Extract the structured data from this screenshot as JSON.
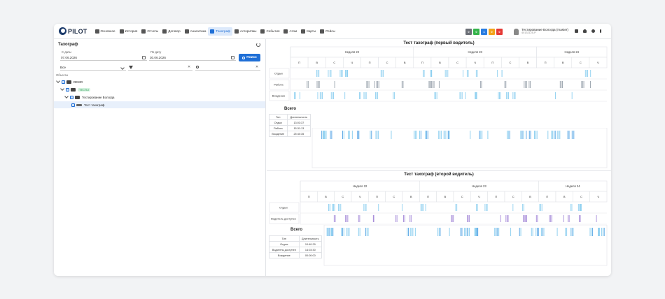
{
  "nav": {
    "logo": "PILOT",
    "items": [
      {
        "label": "Основное",
        "icon": "home-icon"
      },
      {
        "label": "История",
        "icon": "history-icon"
      },
      {
        "label": "Отчеты",
        "icon": "report-icon"
      },
      {
        "label": "Договор",
        "icon": "contract-icon"
      },
      {
        "label": "Аналитика",
        "icon": "analytics-icon"
      },
      {
        "label": "Тахограф",
        "icon": "tachograph-icon",
        "active": true
      },
      {
        "label": "Алгоритмы",
        "icon": "algorithms-icon"
      },
      {
        "label": "События",
        "icon": "bell-icon"
      },
      {
        "label": "Атом",
        "icon": "atom-icon"
      },
      {
        "label": "Карты",
        "icon": "map-icon"
      },
      {
        "label": "Рейсы",
        "icon": "trips-icon"
      }
    ],
    "status_boxes": [
      {
        "value": "0",
        "color": "#6b6f76"
      },
      {
        "value": "0",
        "color": "#34b34a"
      },
      {
        "value": "1",
        "color": "#2a7de1"
      },
      {
        "value": "0",
        "color": "#f2a31a"
      },
      {
        "value": "0",
        "color": "#e53935"
      }
    ],
    "user": {
      "name": "Тестирование Вологда (master)",
      "id": "40132125-P"
    }
  },
  "left_panel": {
    "title": "Тахограф",
    "from_label": "С даты",
    "from_value": "07.06.2026",
    "to_label": "По дату",
    "to_value": "30.06.2026",
    "search_button": "Поиск",
    "select_value": "Все",
    "objects_label": "Объекты",
    "tree": [
      {
        "label": "DEMO",
        "level": 0
      },
      {
        "label": "ТЕСТЫ",
        "level": 1,
        "tag": true
      },
      {
        "label": "Тестирование Вологда",
        "level": 2
      },
      {
        "label": "Тест тахограф",
        "level": 3,
        "selected": true
      }
    ]
  },
  "charts": [
    {
      "title": "Тест тахограф (первый водитель)",
      "weeks": [
        "Неделя 22",
        "Неделя 23",
        "Неделя 24"
      ],
      "days": [
        "П",
        "В",
        "С",
        "Ч",
        "П",
        "С",
        "В",
        "П",
        "В",
        "С",
        "Ч",
        "П",
        "С",
        "В",
        "П",
        "В",
        "С",
        "Ч"
      ],
      "rows": [
        "Отдых",
        "Работа",
        "Вождение"
      ],
      "summary_title": "Всего",
      "summary_headers": [
        "Тип",
        "Длительность"
      ],
      "summary": [
        {
          "type": "Отдых",
          "duration": "13:03:37"
        },
        {
          "type": "Работа",
          "duration": "15:31:13"
        },
        {
          "type": "Вождение",
          "duration": "25:40:35"
        }
      ]
    },
    {
      "title": "Тест тахограф (второй водитель)",
      "weeks": [
        "Неделя 22",
        "Неделя 23",
        "Неделя 24"
      ],
      "days": [
        "П",
        "В",
        "С",
        "Ч",
        "П",
        "С",
        "В",
        "П",
        "В",
        "С",
        "Ч",
        "П",
        "С",
        "В",
        "П",
        "В",
        "С",
        "Ч"
      ],
      "rows": [
        "Отдых",
        "Водитель доступен"
      ],
      "summary_title": "Всего",
      "summary_headers": [
        "Тип",
        "Длительность"
      ],
      "summary": [
        {
          "type": "Отдых",
          "duration": "10:40:29"
        },
        {
          "type": "Водитель доступен",
          "duration": "14:03:30"
        },
        {
          "type": "Вождение",
          "duration": "00:00:00"
        }
      ]
    }
  ],
  "colors": {
    "accent": "#1f6fd6",
    "bar_rest": "#8fd0f0",
    "bar_work": "#9aa3ad",
    "bar_avail": "#a58ad8"
  }
}
